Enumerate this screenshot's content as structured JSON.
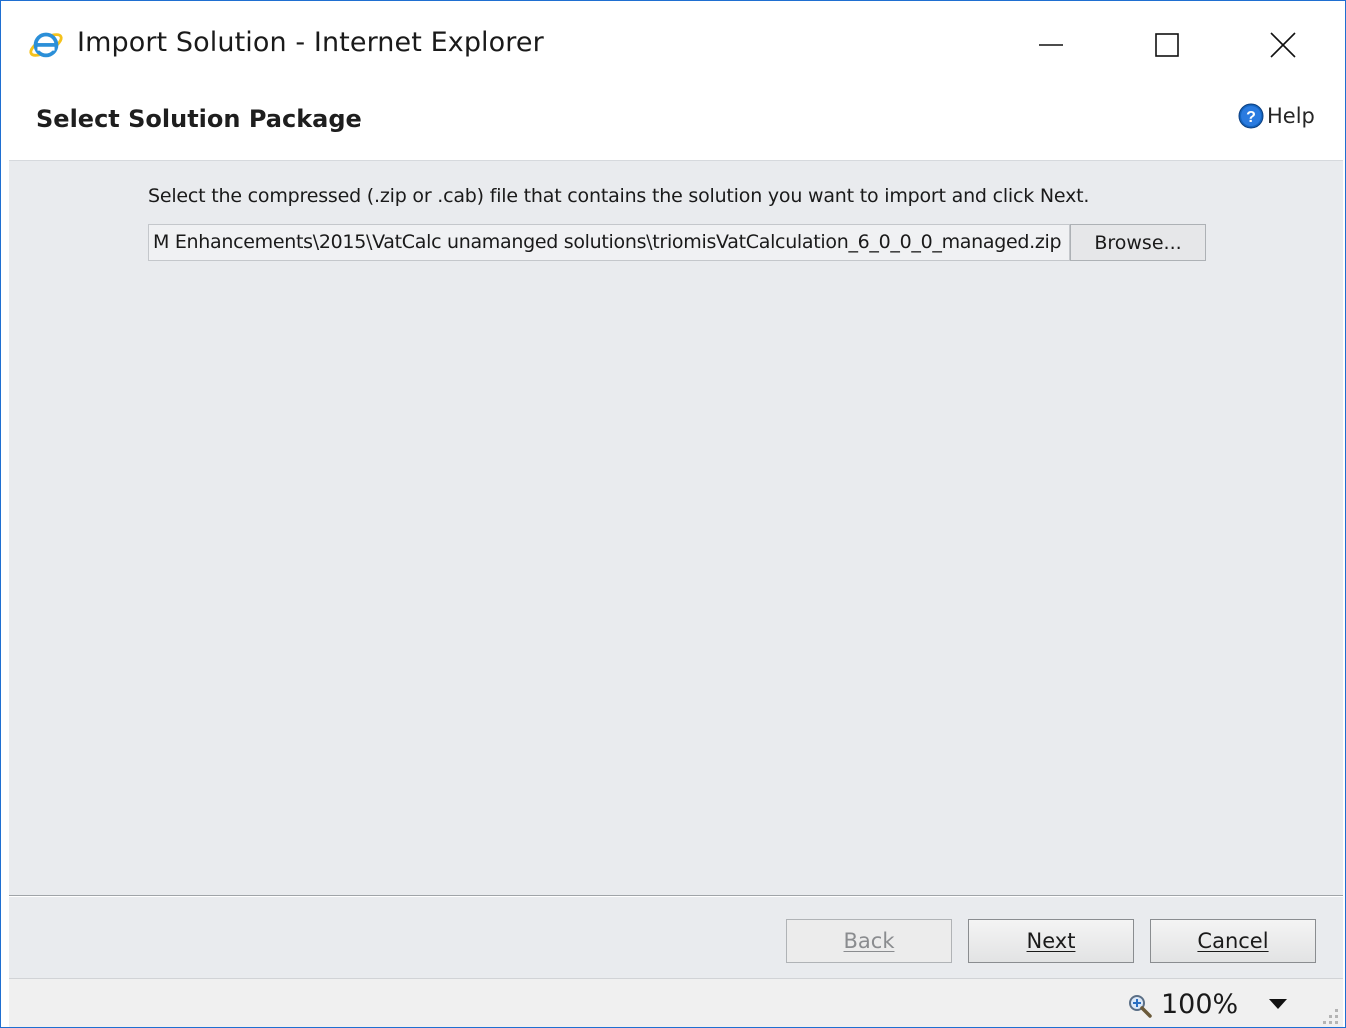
{
  "window": {
    "title": "Import Solution - Internet Explorer"
  },
  "header": {
    "title": "Select Solution Package",
    "help_label": "Help"
  },
  "content": {
    "instruction": "Select the compressed (.zip or .cab) file that contains the solution you want to import and click Next.",
    "file_path": "M Enhancements\\2015\\VatCalc unamanged solutions\\triomisVatCalculation_6_0_0_0_managed.zip",
    "browse_label": "Browse..."
  },
  "footer": {
    "back_label": "Back",
    "next_label": "Next",
    "cancel_label": "Cancel",
    "back_enabled": false
  },
  "statusbar": {
    "zoom": "100%"
  },
  "colors": {
    "accent": "#1f6fd1",
    "content_bg": "#e9ebee",
    "help_icon": "#1565c0"
  }
}
